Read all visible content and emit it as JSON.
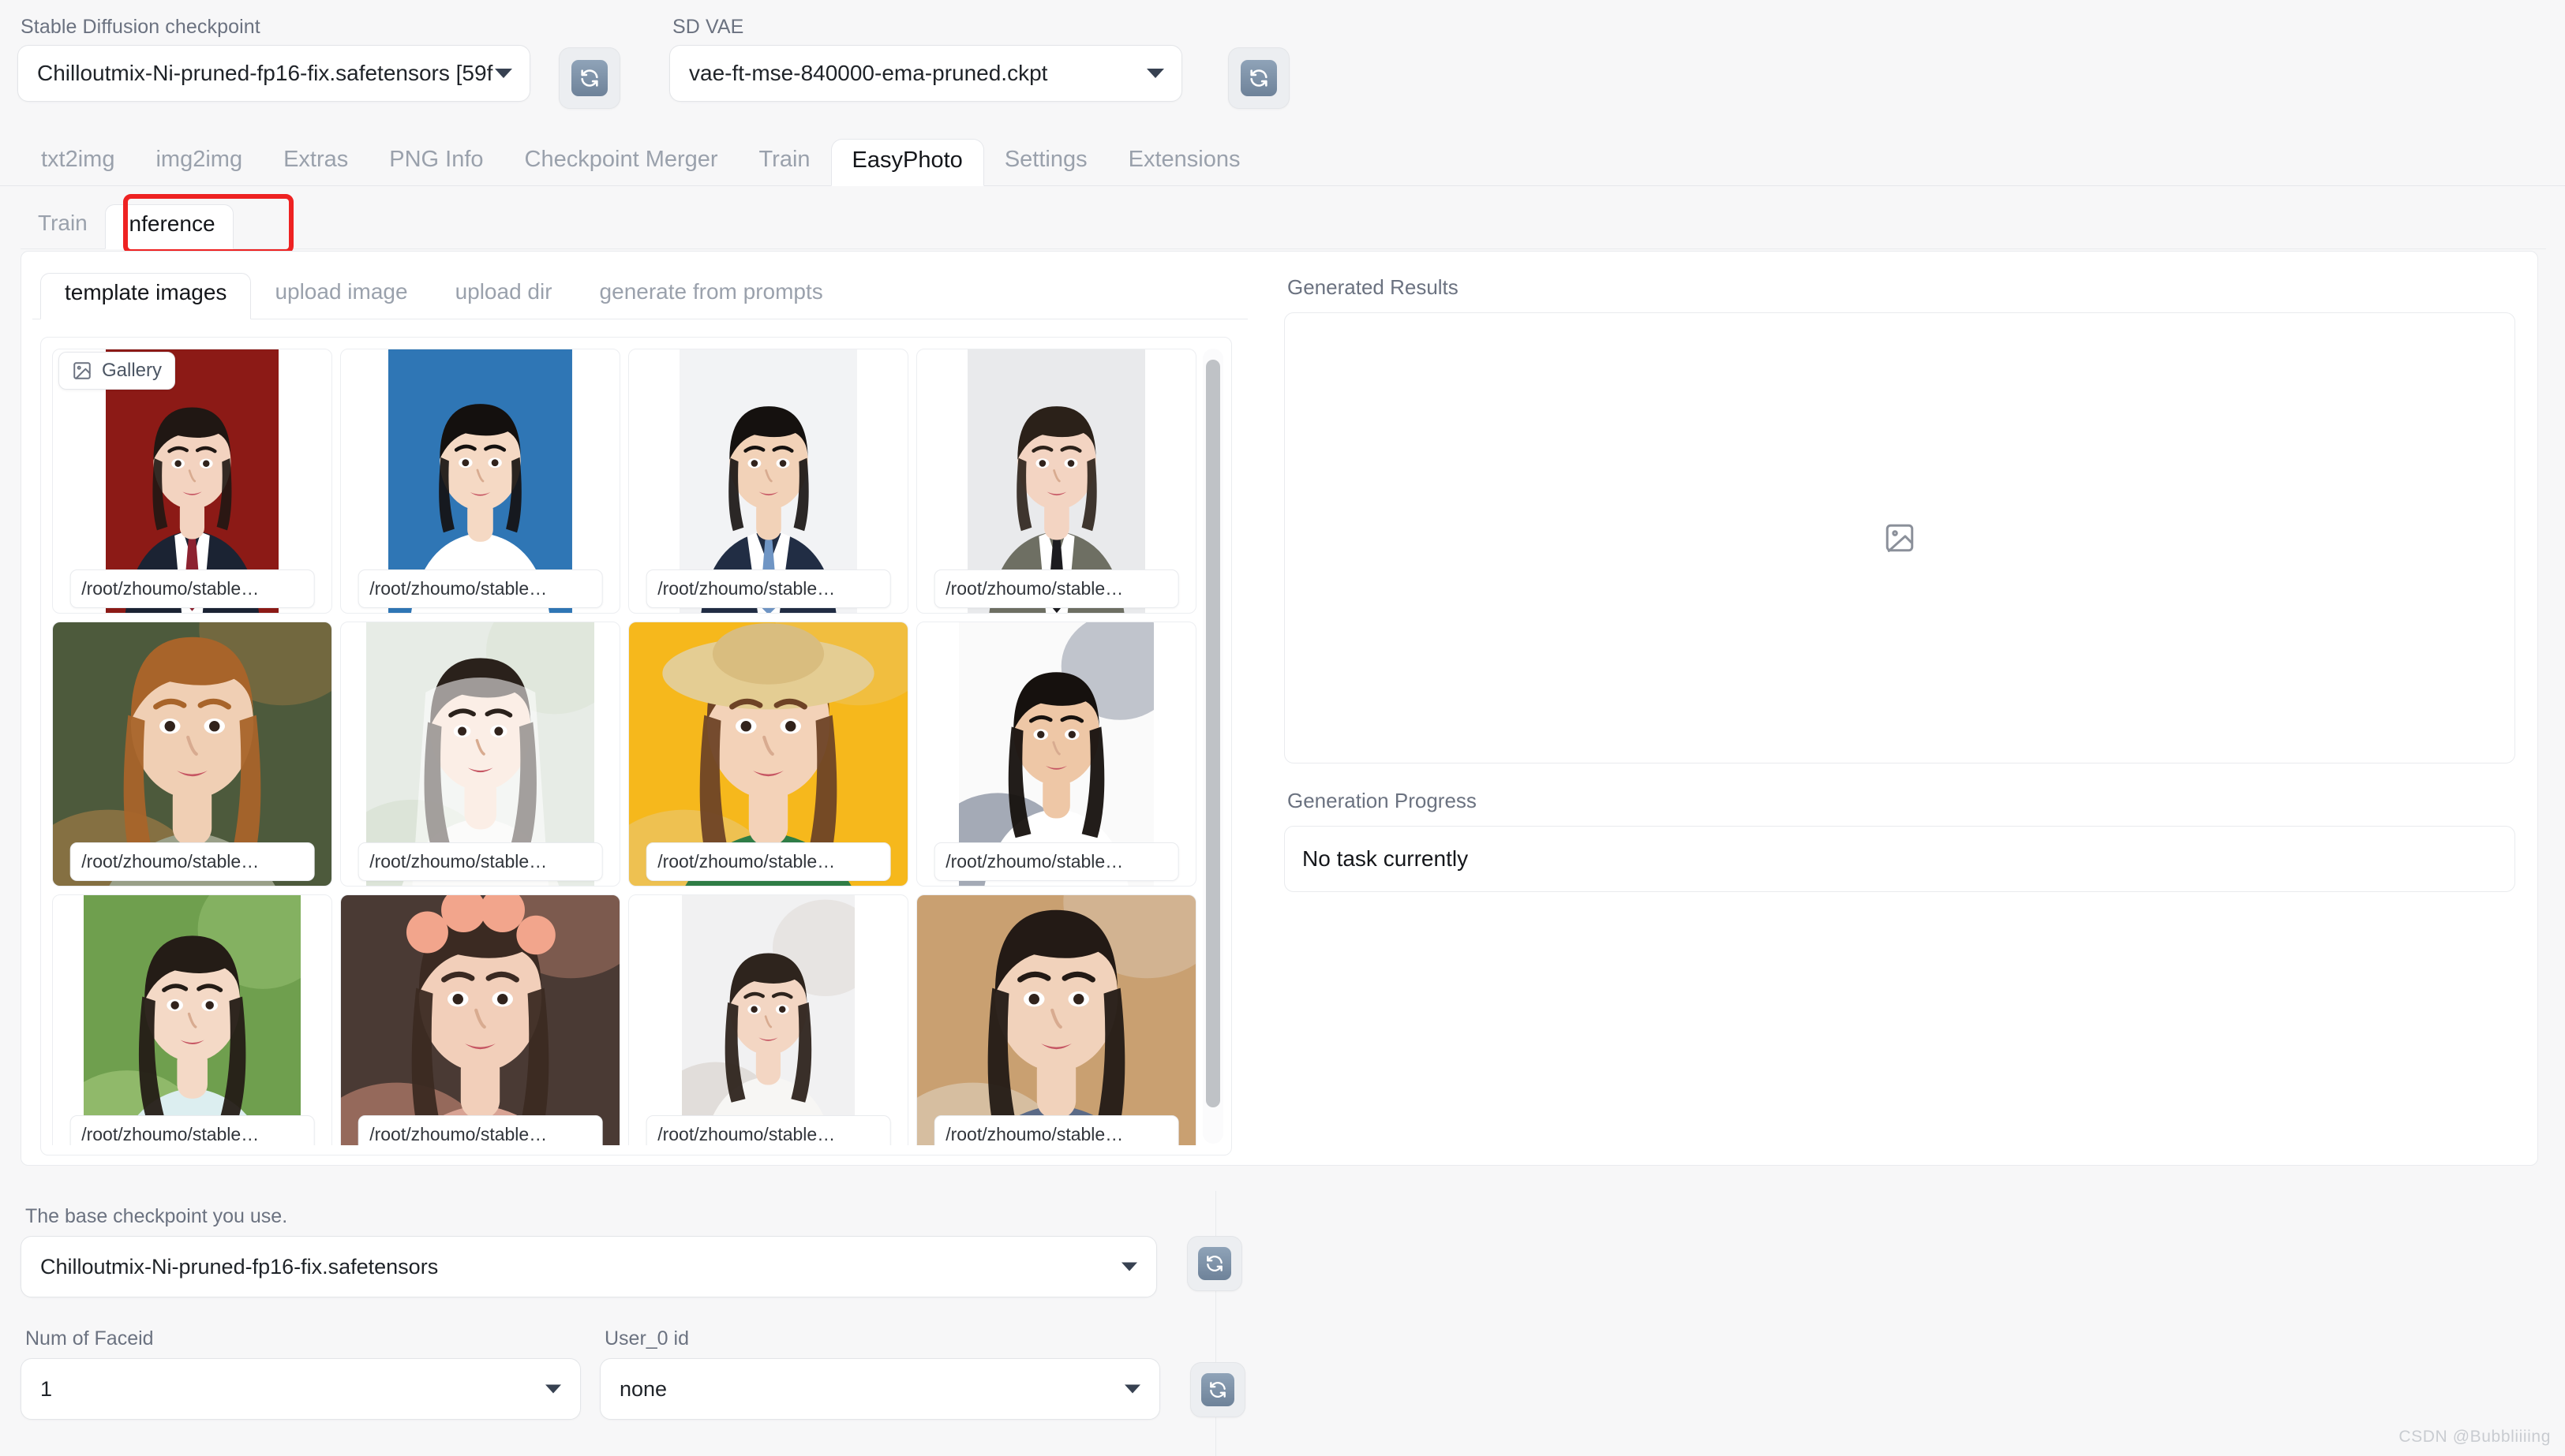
{
  "top": {
    "checkpoint": {
      "label": "Stable Diffusion checkpoint",
      "value": "Chilloutmix-Ni-pruned-fp16-fix.safetensors [59f",
      "refresh_icon": "refresh-icon"
    },
    "vae": {
      "label": "SD VAE",
      "value": "vae-ft-mse-840000-ema-pruned.ckpt",
      "refresh_icon": "refresh-icon"
    }
  },
  "main_tabs": [
    {
      "label": "txt2img",
      "active": false
    },
    {
      "label": "img2img",
      "active": false
    },
    {
      "label": "Extras",
      "active": false
    },
    {
      "label": "PNG Info",
      "active": false
    },
    {
      "label": "Checkpoint Merger",
      "active": false
    },
    {
      "label": "Train",
      "active": false
    },
    {
      "label": "EasyPhoto",
      "active": true
    },
    {
      "label": "Settings",
      "active": false
    },
    {
      "label": "Extensions",
      "active": false
    }
  ],
  "sub_tabs": [
    {
      "label": "Train",
      "active": false
    },
    {
      "label": "Inference",
      "active": true
    }
  ],
  "inner_tabs": [
    {
      "label": "template images",
      "active": true
    },
    {
      "label": "upload image",
      "active": false
    },
    {
      "label": "upload dir",
      "active": false
    },
    {
      "label": "generate from prompts",
      "active": false
    }
  ],
  "gallery": {
    "badge_label": "Gallery",
    "badge_icon": "image-icon",
    "caption": "/root/zhoumo/stable…",
    "items": [
      {
        "caption": "/root/zhoumo/stable…",
        "kind": "id-photo-female-red"
      },
      {
        "caption": "/root/zhoumo/stable…",
        "kind": "id-photo-male-blue"
      },
      {
        "caption": "/root/zhoumo/stable…",
        "kind": "id-photo-male-suit"
      },
      {
        "caption": "/root/zhoumo/stable…",
        "kind": "id-photo-female-gray"
      },
      {
        "caption": "/root/zhoumo/stable…",
        "kind": "portrait-golden-hair"
      },
      {
        "caption": "/root/zhoumo/stable…",
        "kind": "portrait-white-veil"
      },
      {
        "caption": "/root/zhoumo/stable…",
        "kind": "portrait-straw-hat-yellow"
      },
      {
        "caption": "/root/zhoumo/stable…",
        "kind": "portrait-man-tshirt"
      },
      {
        "caption": "/root/zhoumo/stable…",
        "kind": "portrait-green-outdoor"
      },
      {
        "caption": "/root/zhoumo/stable…",
        "kind": "portrait-flower-crown"
      },
      {
        "caption": "/root/zhoumo/stable…",
        "kind": "portrait-long-hair-white"
      },
      {
        "caption": "/root/zhoumo/stable…",
        "kind": "portrait-cafe-desk"
      }
    ]
  },
  "results": {
    "title": "Generated Results",
    "placeholder_icon": "image-placeholder-icon",
    "progress_label": "Generation Progress",
    "progress_value": "No task currently"
  },
  "bottom": {
    "base_checkpoint_label": "The base checkpoint you use.",
    "base_checkpoint_value": "Chilloutmix-Ni-pruned-fp16-fix.safetensors",
    "num_faceid_label": "Num of Faceid",
    "num_faceid_value": "1",
    "user0_label": "User_0 id",
    "user0_value": "none",
    "refresh_icon": "refresh-icon"
  },
  "watermark": "CSDN @Bubbliiiing",
  "colors": {
    "highlight": "#ee2222",
    "accent": "#6e8299",
    "text": "#14161a",
    "muted": "#9aa1ac"
  }
}
